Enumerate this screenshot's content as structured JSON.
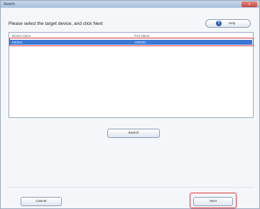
{
  "window": {
    "title": "Search",
    "close_label": "x"
  },
  "instruction": "Please select the target device, and click Next",
  "help": {
    "label": "Help",
    "icon": "help-circle-icon"
  },
  "list": {
    "columns": [
      "Device name",
      "Port Name"
    ],
    "rows": [
      {
        "device": "MK562",
        "port": "USB001",
        "selected": true
      }
    ]
  },
  "buttons": {
    "search": "Search",
    "cancel": "Cancel",
    "next": "Next"
  },
  "colors": {
    "selection": "#3a78d4",
    "highlight": "#d9323a"
  }
}
